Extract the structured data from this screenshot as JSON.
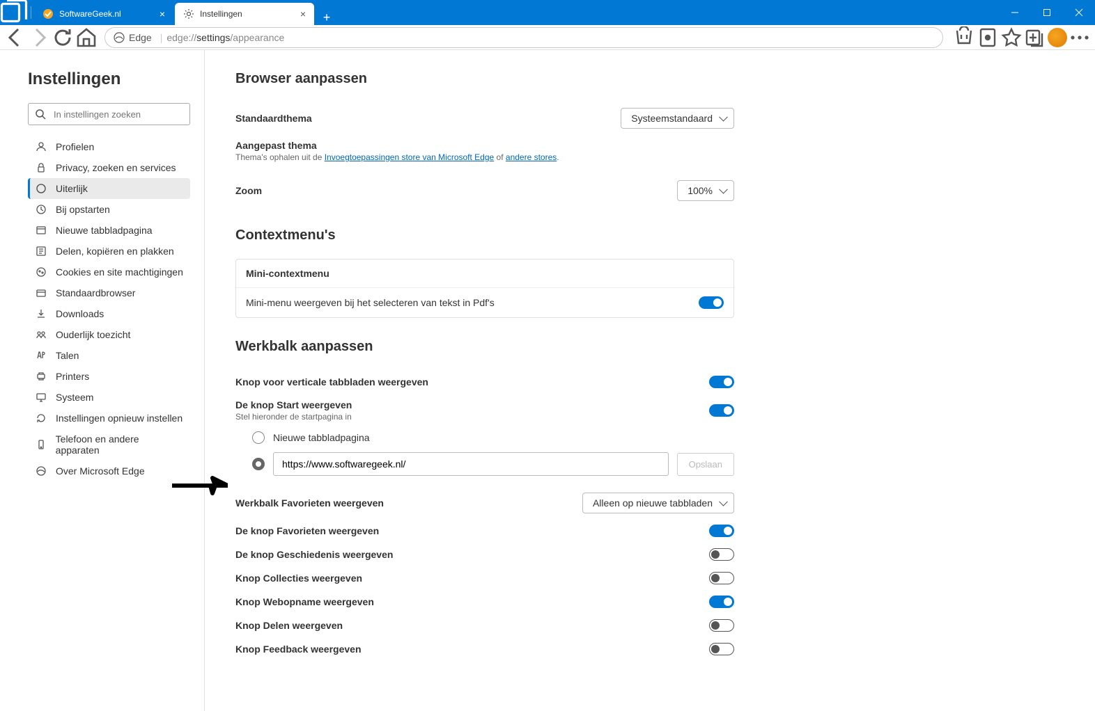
{
  "window": {
    "tabs": [
      {
        "label": "SoftwareGeek.nl",
        "active": false
      },
      {
        "label": "Instellingen",
        "active": true
      }
    ]
  },
  "address": {
    "identity": "Edge",
    "url_prefix": "edge://",
    "url_dark": "settings",
    "url_suffix": "/appearance"
  },
  "sidebar": {
    "title": "Instellingen",
    "search_placeholder": "In instellingen zoeken",
    "items": [
      "Profielen",
      "Privacy, zoeken en services",
      "Uiterlijk",
      "Bij opstarten",
      "Nieuwe tabbladpagina",
      "Delen, kopiëren en plakken",
      "Cookies en site machtigingen",
      "Standaardbrowser",
      "Downloads",
      "Ouderlijk toezicht",
      "Talen",
      "Printers",
      "Systeem",
      "Instellingen opnieuw instellen",
      "Telefoon en andere apparaten",
      "Over Microsoft Edge"
    ],
    "active_index": 2
  },
  "main": {
    "browser_customize": {
      "title": "Browser aanpassen",
      "theme_label": "Standaardthema",
      "theme_value": "Systeemstandaard",
      "custom_theme_label": "Aangepast thema",
      "custom_theme_desc_pre": "Thema's ophalen uit de ",
      "custom_theme_link1": "Invoegtoepassingen store van Microsoft Edge",
      "custom_theme_desc_mid": " of ",
      "custom_theme_link2": "andere stores",
      "zoom_label": "Zoom",
      "zoom_value": "100%"
    },
    "context": {
      "title": "Contextmenu's",
      "mini_header": "Mini-contextmenu",
      "mini_pdf_label": "Mini-menu weergeven bij het selecteren van tekst in Pdf's",
      "mini_pdf_on": true
    },
    "toolbar": {
      "title": "Werkbalk aanpassen",
      "vertical_tabs": {
        "label": "Knop voor verticale tabbladen weergeven",
        "on": true
      },
      "home_button": {
        "label": "De knop Start weergeven",
        "sub": "Stel hieronder de startpagina in",
        "on": true
      },
      "radio_new_tab": "Nieuwe tabbladpagina",
      "url_value": "https://www.softwaregeek.nl/",
      "save_label": "Opslaan",
      "fav_bar": {
        "label": "Werkbalk Favorieten weergeven",
        "value": "Alleen op nieuwe tabbladen"
      },
      "fav_button": {
        "label": "De knop Favorieten weergeven",
        "on": true
      },
      "history_button": {
        "label": "De knop Geschiedenis weergeven",
        "on": false
      },
      "collections_button": {
        "label": "Knop Collecties weergeven",
        "on": false
      },
      "webcapture_button": {
        "label": "Knop Webopname weergeven",
        "on": true
      },
      "share_button": {
        "label": "Knop Delen weergeven",
        "on": false
      },
      "feedback_button": {
        "label": "Knop Feedback weergeven",
        "on": false
      }
    }
  }
}
